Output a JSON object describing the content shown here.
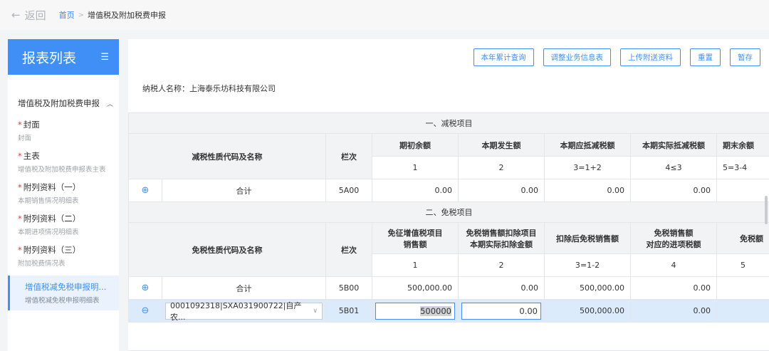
{
  "nav": {
    "back_label": "返回",
    "home_label": "首页",
    "separator": ">",
    "current_label": "增值税及附加税费申报"
  },
  "sidebar": {
    "title": "报表列表",
    "group_label": "增值税及附加税费申报",
    "items": [
      {
        "name": "封面",
        "sub": "封面",
        "required": "*"
      },
      {
        "name": "主表",
        "sub": "增值税及附加税费申报表主表",
        "required": "*"
      },
      {
        "name": "附列资料（一）",
        "sub": "本期销售情况明细表",
        "required": "*"
      },
      {
        "name": "附列资料（二）",
        "sub": "本期进项情况明细表",
        "required": "*"
      },
      {
        "name": "附列资料（三）",
        "sub": "附加税费情况表",
        "required": "*"
      },
      {
        "name": "增值税减免税申报明...",
        "sub": "增值税减免税申报明细表",
        "required": ""
      }
    ]
  },
  "toolbar": {
    "annual_query": "本年累计查询",
    "adjust_info": "调整业务信息表",
    "upload": "上传附送资料",
    "reset": "重置",
    "save_draft": "暂存"
  },
  "taxpayer": {
    "label": "纳税人名称：上海泰乐坊科技有限公司"
  },
  "reduction": {
    "section_title": "一、减税项目",
    "col_name": "减税性质代码及名称",
    "col_line": "栏次",
    "headers": [
      "期初余额",
      "本期发生额",
      "本期应抵减税额",
      "本期实际抵减税额",
      "期末余额"
    ],
    "formulas": [
      "1",
      "2",
      "3=1+2",
      "4≤3",
      "5=3-4"
    ],
    "total_row": {
      "label": "合计",
      "line": "5A00",
      "values": [
        "0.00",
        "0.00",
        "0.00",
        "0.00"
      ]
    }
  },
  "exemption": {
    "section_title": "二、免税项目",
    "col_name": "免税性质代码及名称",
    "col_line": "栏次",
    "headers": [
      [
        "免征增值税项目",
        "销售额"
      ],
      [
        "免税销售额扣除项目",
        "本期实际扣除金额"
      ],
      [
        "扣除后免税销售额"
      ],
      [
        "免税销售额",
        "对应的进项税额"
      ],
      [
        "免税额"
      ]
    ],
    "formulas": [
      "1",
      "2",
      "3=1-2",
      "4",
      "5"
    ],
    "total_row": {
      "label": "合计",
      "line": "5B00",
      "values": [
        "500,000.00",
        "0.00",
        "500,000.00",
        "0.00"
      ]
    },
    "detail_row": {
      "select_value": "0001092318|SXA031900722|自产农...",
      "line": "5B01",
      "input_sales": "500000",
      "input_deduct": "0.00",
      "after_deduct": "500,000.00",
      "input_tax": "0.00"
    }
  }
}
